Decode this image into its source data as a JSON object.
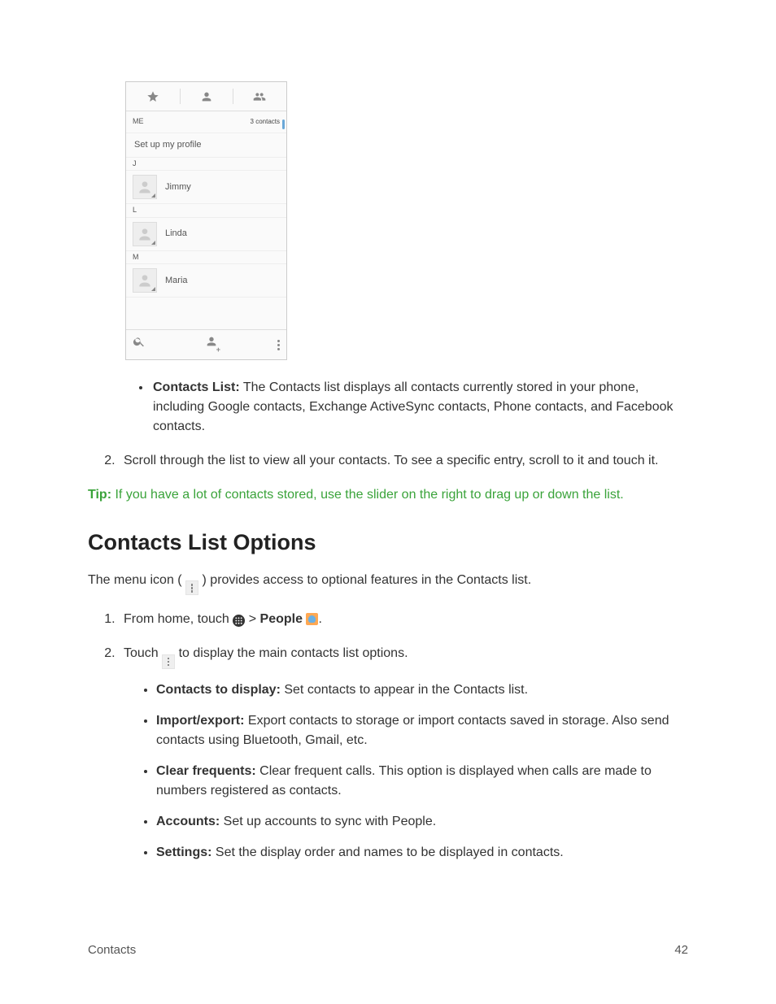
{
  "phone": {
    "me_label": "ME",
    "count_label": "3 contacts",
    "profile_label": "Set up my profile",
    "sections": [
      {
        "letter": "J",
        "contacts": [
          "Jimmy"
        ]
      },
      {
        "letter": "L",
        "contacts": [
          "Linda"
        ]
      },
      {
        "letter": "M",
        "contacts": [
          "Maria"
        ]
      }
    ]
  },
  "bullet_intro": {
    "label": "Contacts List:",
    "text": " The Contacts list displays all contacts currently stored in your phone, including Google contacts, Exchange ActiveSync contacts, Phone contacts, and Facebook contacts."
  },
  "step2": "Scroll through the list to view all your contacts. To see a specific entry, scroll to it and touch it.",
  "tip": {
    "label": "Tip:",
    "text": " If you have a lot of contacts stored, use the slider on the right to drag up or down the list."
  },
  "heading": "Contacts List Options",
  "intro_before": "The menu icon (",
  "intro_after": ") provides access to optional features in the Contacts list.",
  "steps": {
    "one_a": "From home, touch ",
    "one_gt": " > ",
    "one_people": "People",
    "one_period": ".",
    "two_a": "Touch ",
    "two_b": " to display the main contacts list options."
  },
  "options": [
    {
      "label": "Contacts to display:",
      "text": " Set contacts to appear in the Contacts list."
    },
    {
      "label": "Import/export:",
      "text": " Export contacts to storage or import contacts saved in storage. Also send contacts using Bluetooth, Gmail, etc."
    },
    {
      "label": "Clear frequents:",
      "text": " Clear frequent calls. This option is displayed when calls are made to numbers registered as contacts."
    },
    {
      "label": "Accounts:",
      "text": " Set up accounts to sync with People."
    },
    {
      "label": "Settings:",
      "text": " Set the display order and names to be displayed in contacts."
    }
  ],
  "footer": {
    "section": "Contacts",
    "page": "42"
  }
}
